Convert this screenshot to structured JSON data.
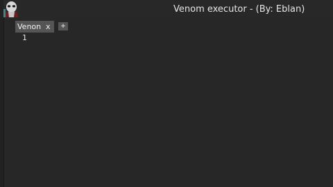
{
  "window": {
    "title": "Venom executor - (By: Eblan)"
  },
  "tabs": [
    {
      "label": "Venon",
      "close_label": "x"
    }
  ],
  "add_tab_label": "+",
  "editor": {
    "line_numbers": [
      "1"
    ]
  }
}
